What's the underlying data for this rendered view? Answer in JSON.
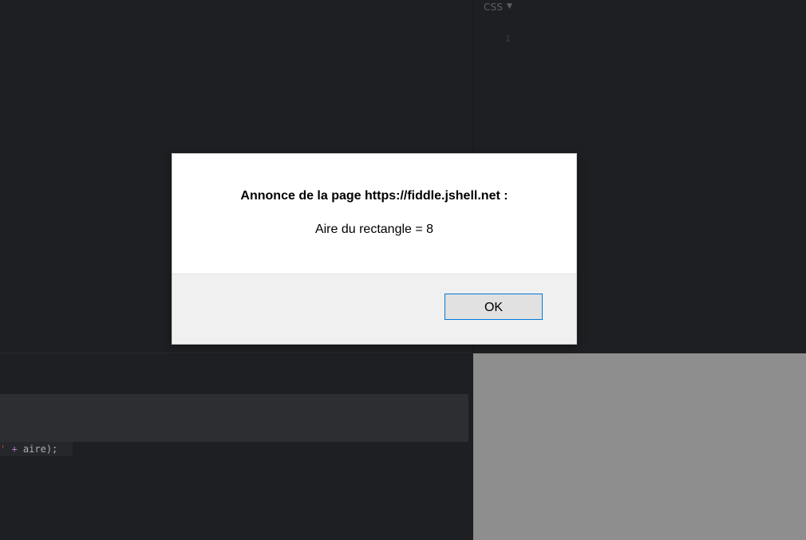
{
  "editor": {
    "css_pane": {
      "language_label": "CSS",
      "dropdown_arrow": "▼",
      "line_numbers": [
        "1"
      ]
    },
    "js_pane": {
      "visible_code_fragment": {
        "string_tail": "'",
        "operator": " + ",
        "rest": "aire);"
      }
    },
    "result_pane": {
      "background_color": "#8e8e8e"
    }
  },
  "alert_dialog": {
    "title": "Annonce de la page https://fiddle.jshell.net :",
    "message": "Aire du rectangle = 8",
    "ok_label": "OK",
    "ok_border_color": "#0078d7"
  }
}
